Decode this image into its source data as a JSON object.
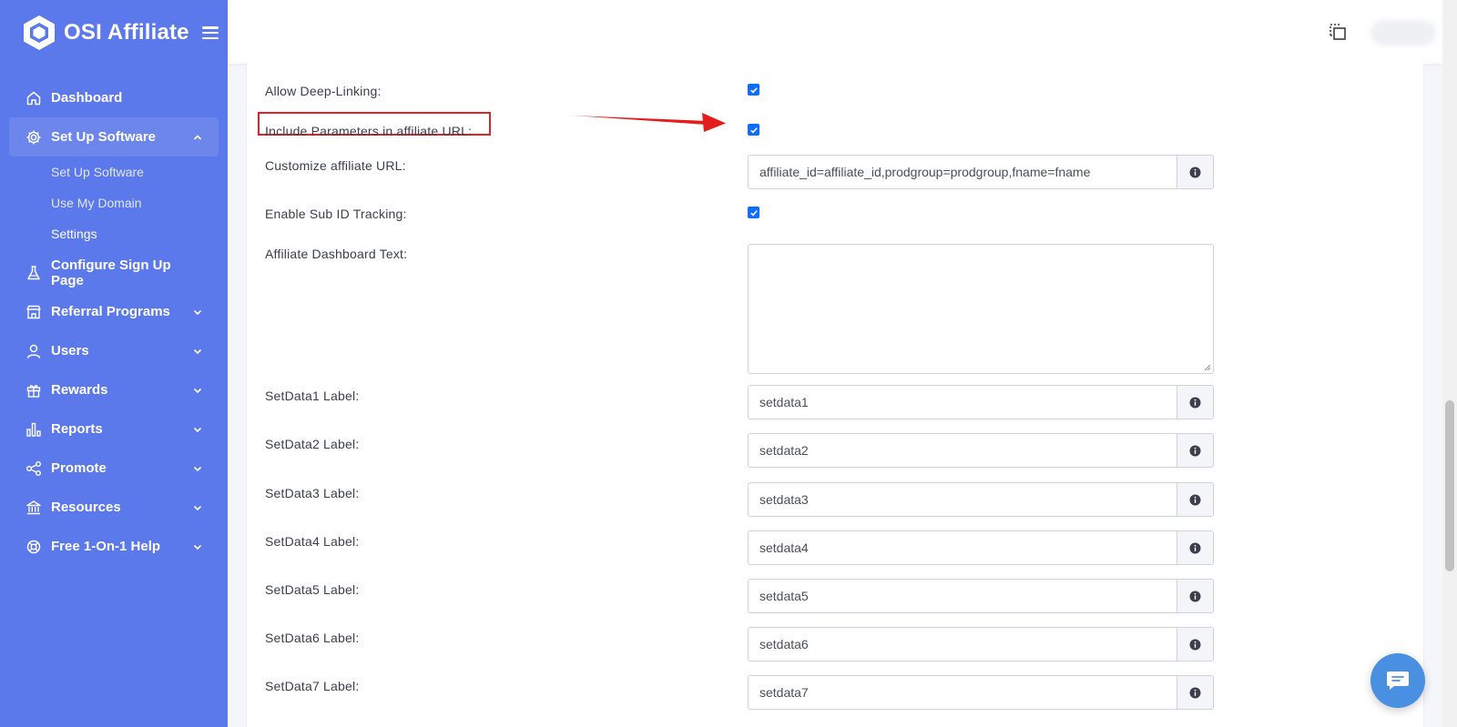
{
  "brand": {
    "name": "OSI Affiliate"
  },
  "sidebar": {
    "items": [
      {
        "label": "Dashboard",
        "icon": "home-icon"
      },
      {
        "label": "Set Up Software",
        "icon": "gear-icon",
        "expanded": true,
        "children": [
          {
            "label": "Set Up Software"
          },
          {
            "label": "Use My Domain"
          },
          {
            "label": "Settings"
          }
        ]
      },
      {
        "label": "Configure Sign Up Page",
        "icon": "flask-icon"
      },
      {
        "label": "Referral Programs",
        "icon": "store-icon"
      },
      {
        "label": "Users",
        "icon": "user-icon"
      },
      {
        "label": "Rewards",
        "icon": "gift-icon"
      },
      {
        "label": "Reports",
        "icon": "bar-chart-icon"
      },
      {
        "label": "Promote",
        "icon": "share-icon"
      },
      {
        "label": "Resources",
        "icon": "bank-icon"
      },
      {
        "label": "Free 1-On-1 Help",
        "icon": "lifebuoy-icon"
      }
    ]
  },
  "form": {
    "allow_deep_linking": {
      "label": "Allow Deep-Linking:",
      "checked": true
    },
    "include_params": {
      "label": "Include Parameters in affiliate URL:",
      "checked": true
    },
    "customize_url": {
      "label": "Customize affiliate URL:",
      "value": "affiliate_id=affiliate_id,prodgroup=prodgroup,fname=fname"
    },
    "sub_id": {
      "label": "Enable Sub ID Tracking:",
      "checked": true
    },
    "dashboard_text": {
      "label": "Affiliate Dashboard Text:",
      "value": ""
    },
    "setdata": [
      {
        "label": "SetData1 Label:",
        "value": "setdata1"
      },
      {
        "label": "SetData2 Label:",
        "value": "setdata2"
      },
      {
        "label": "SetData3 Label:",
        "value": "setdata3"
      },
      {
        "label": "SetData4 Label:",
        "value": "setdata4"
      },
      {
        "label": "SetData5 Label:",
        "value": "setdata5"
      },
      {
        "label": "SetData6 Label:",
        "value": "setdata6"
      },
      {
        "label": "SetData7 Label:",
        "value": "setdata7"
      }
    ]
  },
  "colors": {
    "sidebar": "#5b79ea",
    "accent": "#0d6efd",
    "highlight": "#e02424",
    "chat": "#4a90e2"
  }
}
